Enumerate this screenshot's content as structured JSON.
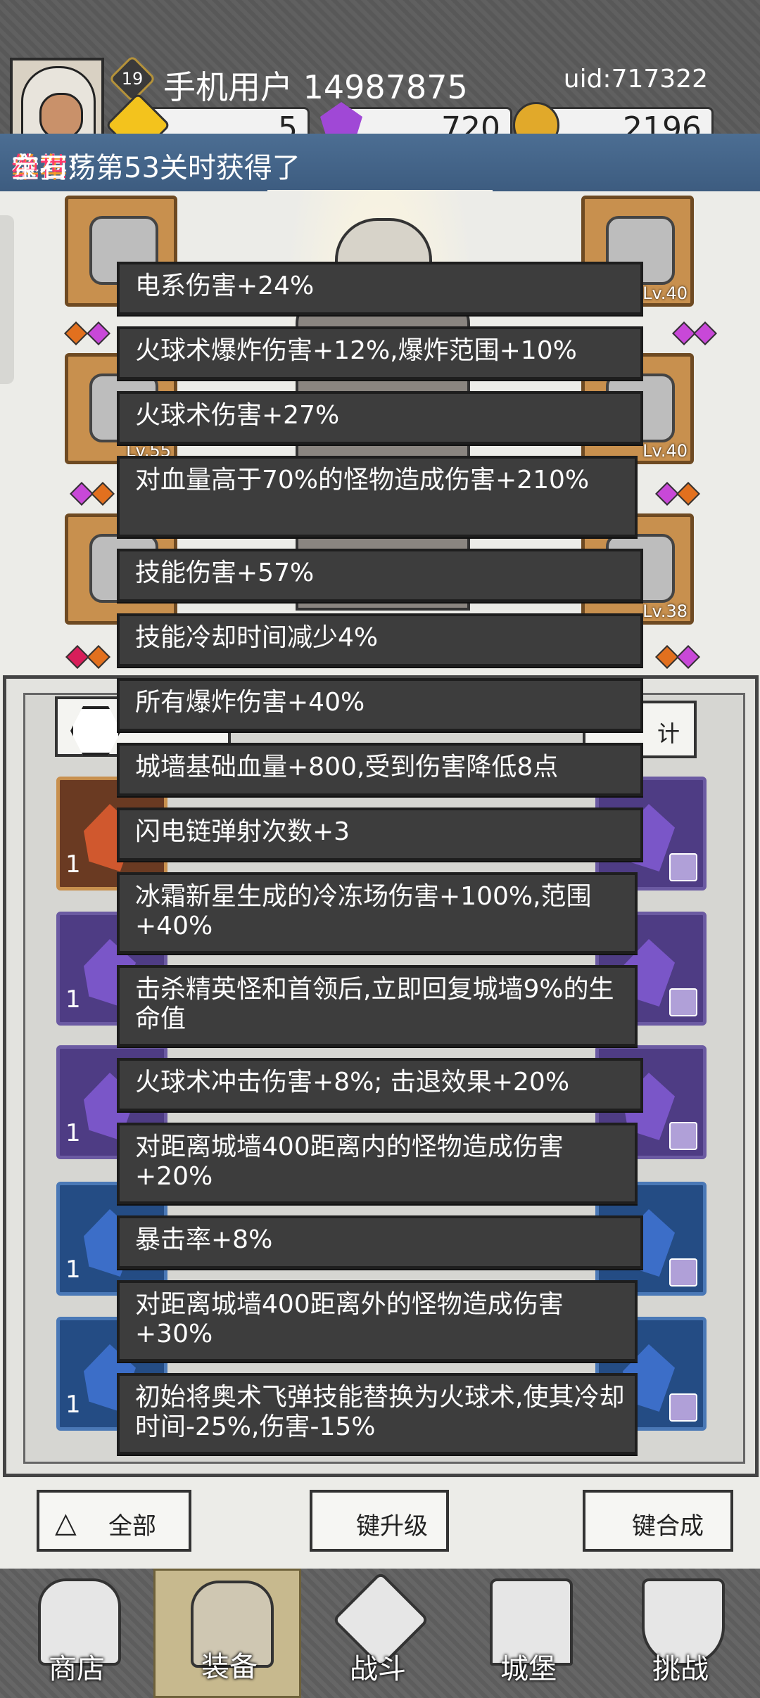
{
  "header": {
    "level": "19",
    "username": "手机用户 14987875",
    "uid": "uid:717322",
    "currencies": {
      "gold_crystal": "5",
      "purple_gem": "720",
      "coin": "2196"
    },
    "currency_icons": [
      "yellow-crystal-icon",
      "purple-diamond-icon",
      "gold-coin-icon"
    ]
  },
  "broadcast": {
    "prefix": "恭喜 ",
    "player": "单车",
    "middle": " 在扫荡第53关时获得了 ",
    "rarity": "绝世",
    "suffix": " 宝石!"
  },
  "equipment_levels": [
    "Lv.40",
    "Lv.55",
    "Lv.40",
    "Lv.38"
  ],
  "inventory": {
    "stats_button": "计",
    "card_counts": [
      "1",
      "1",
      "1",
      "1",
      "1",
      "1"
    ],
    "bottom_buttons": {
      "all": "全部",
      "upgrade": "键升级",
      "merge": "键合成"
    }
  },
  "tooltips": [
    "电系伤害+24%",
    "火球术爆炸伤害+12%,爆炸范围+10%",
    "火球术伤害+27%",
    "对血量高于70%的怪物造成伤害+210%",
    "技能伤害+57%",
    "技能冷却时间减少4%",
    "所有爆炸伤害+40%",
    "城墙基础血量+800,受到伤害降低8点",
    "闪电链弹射次数+3",
    "冰霜新星生成的冷冻场伤害+100%,范围+40%",
    "击杀精英怪和首领后,立即回复城墙9%的生命值",
    "火球术冲击伤害+8%; 击退效果+20%",
    "对距离城墙400距离内的怪物造成伤害+20%",
    "暴击率+8%",
    "对距离城墙400距离外的怪物造成伤害+30%",
    "初始将奥术飞弹技能替换为火球术,使其冷却时间-25%,伤害-15%"
  ],
  "nav": [
    {
      "label": "商店",
      "icon": "shop-icon"
    },
    {
      "label": "装备",
      "icon": "backpack-icon"
    },
    {
      "label": "战斗",
      "icon": "crossed-swords-icon"
    },
    {
      "label": "城堡",
      "icon": "castle-icon"
    },
    {
      "label": "挑战",
      "icon": "shield-icon"
    }
  ],
  "colors": {
    "player_highlight": "#f39a2a",
    "rarity_highlight": "#ff3a6c",
    "tooltip_bg": "#3d3d3d"
  }
}
